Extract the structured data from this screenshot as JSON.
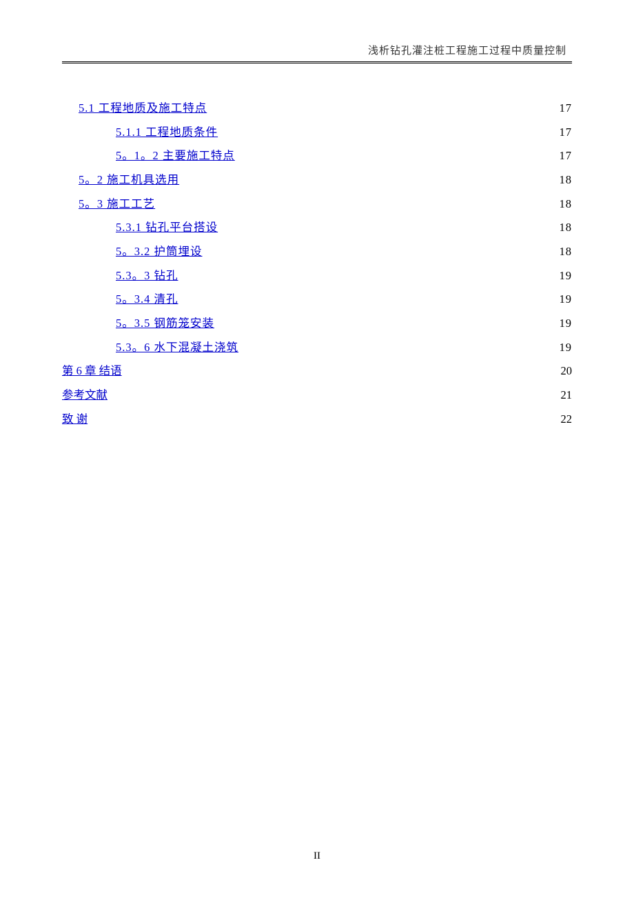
{
  "header": {
    "title": "浅析钻孔灌注桩工程施工过程中质量控制"
  },
  "toc": [
    {
      "level": 1,
      "label": "5.1 工程地质及施工特点",
      "page": "17",
      "leader": "dots"
    },
    {
      "level": 2,
      "label": "5.1.1 工程地质条件",
      "page": "17",
      "leader": "dots"
    },
    {
      "level": 2,
      "label": "5。1。2 主要施工特点",
      "page": "17",
      "leader": "dots"
    },
    {
      "level": 1,
      "label": "5。2 施工机具选用",
      "page": "18",
      "leader": "dots"
    },
    {
      "level": 1,
      "label": "5。3 施工工艺",
      "page": "18",
      "leader": "dots"
    },
    {
      "level": 2,
      "label": "5.3.1 钻孔平台搭设",
      "page": "18",
      "leader": "dots"
    },
    {
      "level": 2,
      "label": "5。3.2 护筒埋设",
      "page": "18",
      "leader": "dots"
    },
    {
      "level": 2,
      "label": "5.3。3  钻孔",
      "page": "19",
      "leader": "dots"
    },
    {
      "level": 2,
      "label": "5。3.4 清孔",
      "page": "19",
      "leader": "dots"
    },
    {
      "level": 2,
      "label": "5。3.5 钢筋笼安装",
      "page": "19",
      "leader": "dots"
    },
    {
      "level": 2,
      "label": "5.3。6 水下混凝土浇筑",
      "page": "19",
      "leader": "dots"
    },
    {
      "level": 0,
      "label": "第 6 章  结语",
      "page": "20",
      "leader": "line"
    },
    {
      "level": 0,
      "label": "参考文献",
      "page": "21",
      "leader": "line"
    },
    {
      "level": 0,
      "label": "致  谢",
      "page": "22",
      "leader": "line"
    }
  ],
  "footer": {
    "page_number": "II"
  }
}
